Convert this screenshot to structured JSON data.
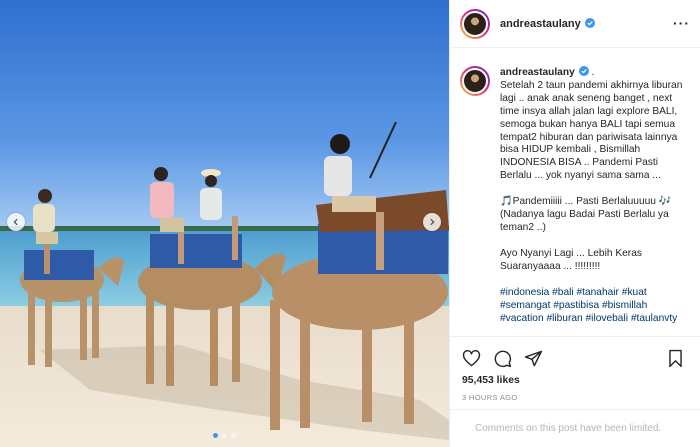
{
  "post": {
    "username": "andreastaulany",
    "caption_lines": [
      "Setelah 2 taun pandemi akhirnya liburan",
      "lagi .. anak anak seneng banget , next",
      "time insya allah jalan lagi explore BALI,",
      "semoga bukan hanya BALI tapi semua",
      "tempat2 hiburan dan pariwisata lainnya",
      "bisa HIDUP kembali , Bismillah",
      "INDONESIA BISA .. Pandemi Pasti",
      "Berlalu ... yok nyanyi sama sama ..."
    ],
    "song_lines": [
      "🎵Pandemiiiii ... Pasti Berlaluuuuu 🎶",
      "(Nadanya lagu Badai Pasti Berlalu ya",
      "teman2 ..)"
    ],
    "sing_lines": [
      "Ayo Nyanyi Lagi ... Lebih Keras",
      "Suaranyaaaa ... !!!!!!!!!"
    ],
    "hashtag_lines": [
      "#indonesia #bali #tanahair #kuat",
      "#semangat #pastibisa #bismillah",
      "#vacation #liburan #ilovebali #taulanvty"
    ],
    "caption_dot": ".",
    "likes": "95,453 likes",
    "time_ago": "3 HOURS AGO",
    "comments_notice": "Comments on this post have been limited.",
    "more_label": "···"
  },
  "icons": {
    "header_menu": "more-options-icon",
    "verified": "verified-badge-icon",
    "like": "heart-icon",
    "comment": "comment-icon",
    "share": "paper-plane-icon",
    "save": "bookmark-icon",
    "prev": "chevron-left-icon",
    "next": "chevron-right-icon"
  },
  "carousel": {
    "count": 3,
    "active": 0
  },
  "colors": {
    "accent": "#3897f0",
    "text": "#262626",
    "muted": "#8e8e8e",
    "hashtag": "#00376b"
  }
}
